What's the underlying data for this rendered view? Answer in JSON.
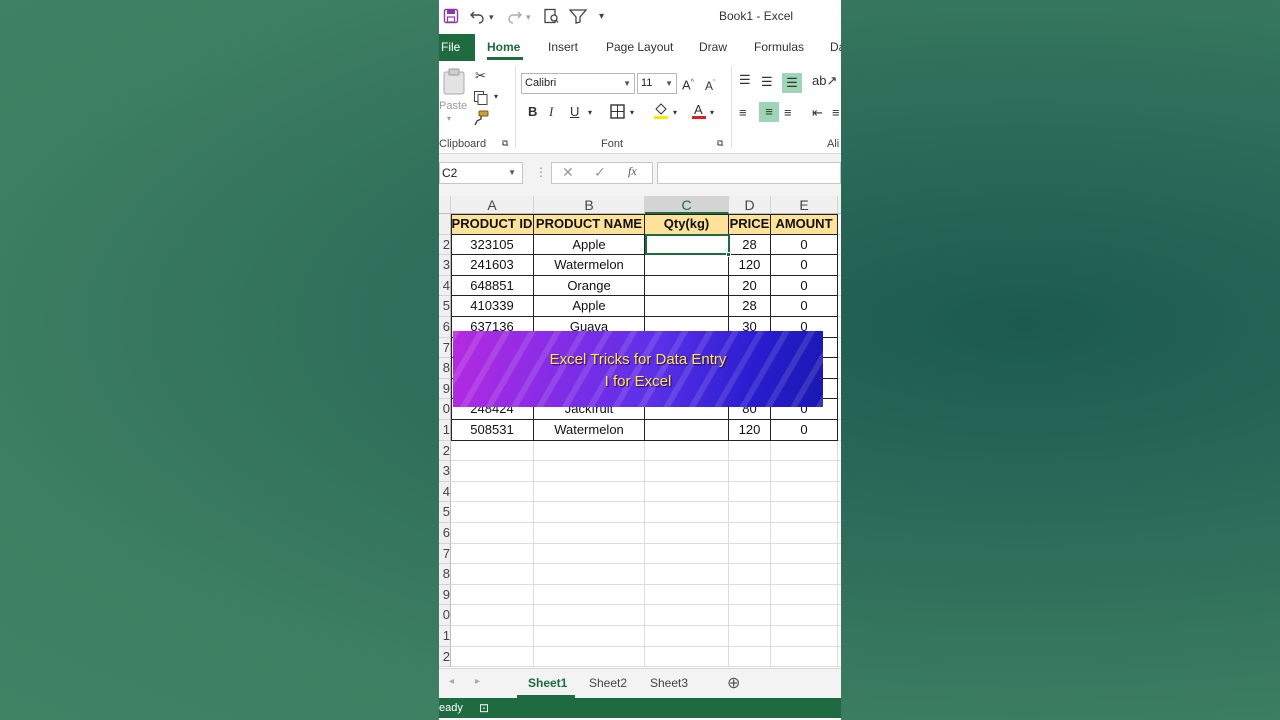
{
  "window": {
    "title": "Book1  -  Excel"
  },
  "qat": {
    "save_icon": "save-icon",
    "undo_icon": "undo-icon",
    "redo_icon": "redo-icon",
    "print_preview_icon": "print-preview-icon",
    "filter_icon": "filter-icon",
    "customize_icon": "chevron-down-icon"
  },
  "tabs": {
    "file": "File",
    "items": [
      "Home",
      "Insert",
      "Page Layout",
      "Draw",
      "Formulas",
      "Da"
    ],
    "active": "Home"
  },
  "ribbon": {
    "clipboard": {
      "label": "Clipboard",
      "paste": "Paste"
    },
    "font": {
      "label": "Font",
      "name": "Calibri",
      "size": "11"
    },
    "alignment": {
      "label": "Ali"
    }
  },
  "formula_bar": {
    "name_box": "C2",
    "fx": "fx",
    "value": ""
  },
  "columns": [
    "A",
    "B",
    "C",
    "D",
    "E"
  ],
  "selected_column": "C",
  "row_numbers": [
    "2",
    "3",
    "4",
    "5",
    "6",
    "7",
    "8",
    "9",
    "0",
    "1",
    "2",
    "3",
    "4",
    "5",
    "6",
    "7",
    "8",
    "9",
    "0",
    "1",
    "2"
  ],
  "table": {
    "headers": [
      "PRODUCT ID",
      "PRODUCT NAME",
      "Qty(kg)",
      "PRICE",
      "AMOUNT"
    ],
    "rows": [
      [
        "323105",
        "Apple",
        "",
        "28",
        "0"
      ],
      [
        "241603",
        "Watermelon",
        "",
        "120",
        "0"
      ],
      [
        "648851",
        "Orange",
        "",
        "20",
        "0"
      ],
      [
        "410339",
        "Apple",
        "",
        "28",
        "0"
      ],
      [
        "637136",
        "Guava",
        "",
        "30",
        "0"
      ],
      [
        "",
        "",
        "",
        "",
        ""
      ],
      [
        "",
        "",
        "",
        "",
        ""
      ],
      [
        "",
        "",
        "",
        "",
        ""
      ],
      [
        "248424",
        "Jackfruit",
        "",
        "80",
        "0"
      ],
      [
        "508531",
        "Watermelon",
        "",
        "120",
        "0"
      ]
    ]
  },
  "overlay": {
    "line1": "Excel Tricks for Data Entry",
    "line2": "I for Excel"
  },
  "sheets": {
    "tabs": [
      "Sheet1",
      "Sheet2",
      "Sheet3"
    ],
    "active": "Sheet1",
    "add_icon": "plus-circle-icon"
  },
  "status": {
    "text": "eady"
  },
  "colors": {
    "excel_green": "#1e6b40",
    "header_fill": "#ffe29a",
    "banner_purple": "#8a2ce6",
    "banner_text": "#ffe94a"
  }
}
